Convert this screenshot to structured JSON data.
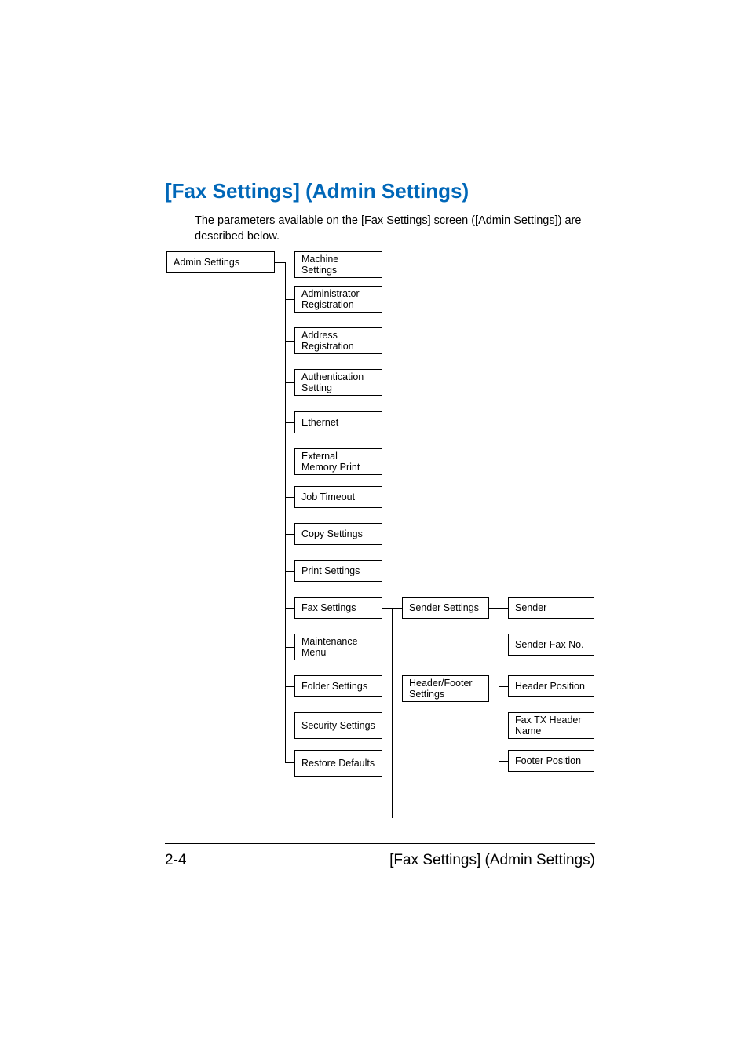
{
  "heading": "[Fax Settings] (Admin Settings)",
  "intro": "The parameters available on the [Fax Settings] screen ([Admin Settings]) are described below.",
  "root": "Admin Settings",
  "col1": {
    "a": "Machine Settings",
    "b": "Administrator Registration",
    "c": "Address Registration",
    "d": "Authentication Setting",
    "e": "Ethernet",
    "f": "External Memory Print",
    "g": "Job Timeout",
    "h": "Copy Settings",
    "i": "Print Settings",
    "j": "Fax Settings",
    "k": "Maintenance Menu",
    "l": "Folder Settings",
    "m": "Security Settings",
    "n": "Restore Defaults"
  },
  "col2": {
    "a": "Sender Settings",
    "b": "Header/Footer Settings"
  },
  "col3": {
    "a": "Sender",
    "b": "Sender Fax No.",
    "c": "Header Position",
    "d": "Fax TX Header Name",
    "e": "Footer Position"
  },
  "footer": {
    "left": "2-4",
    "right": "[Fax Settings] (Admin Settings)"
  }
}
